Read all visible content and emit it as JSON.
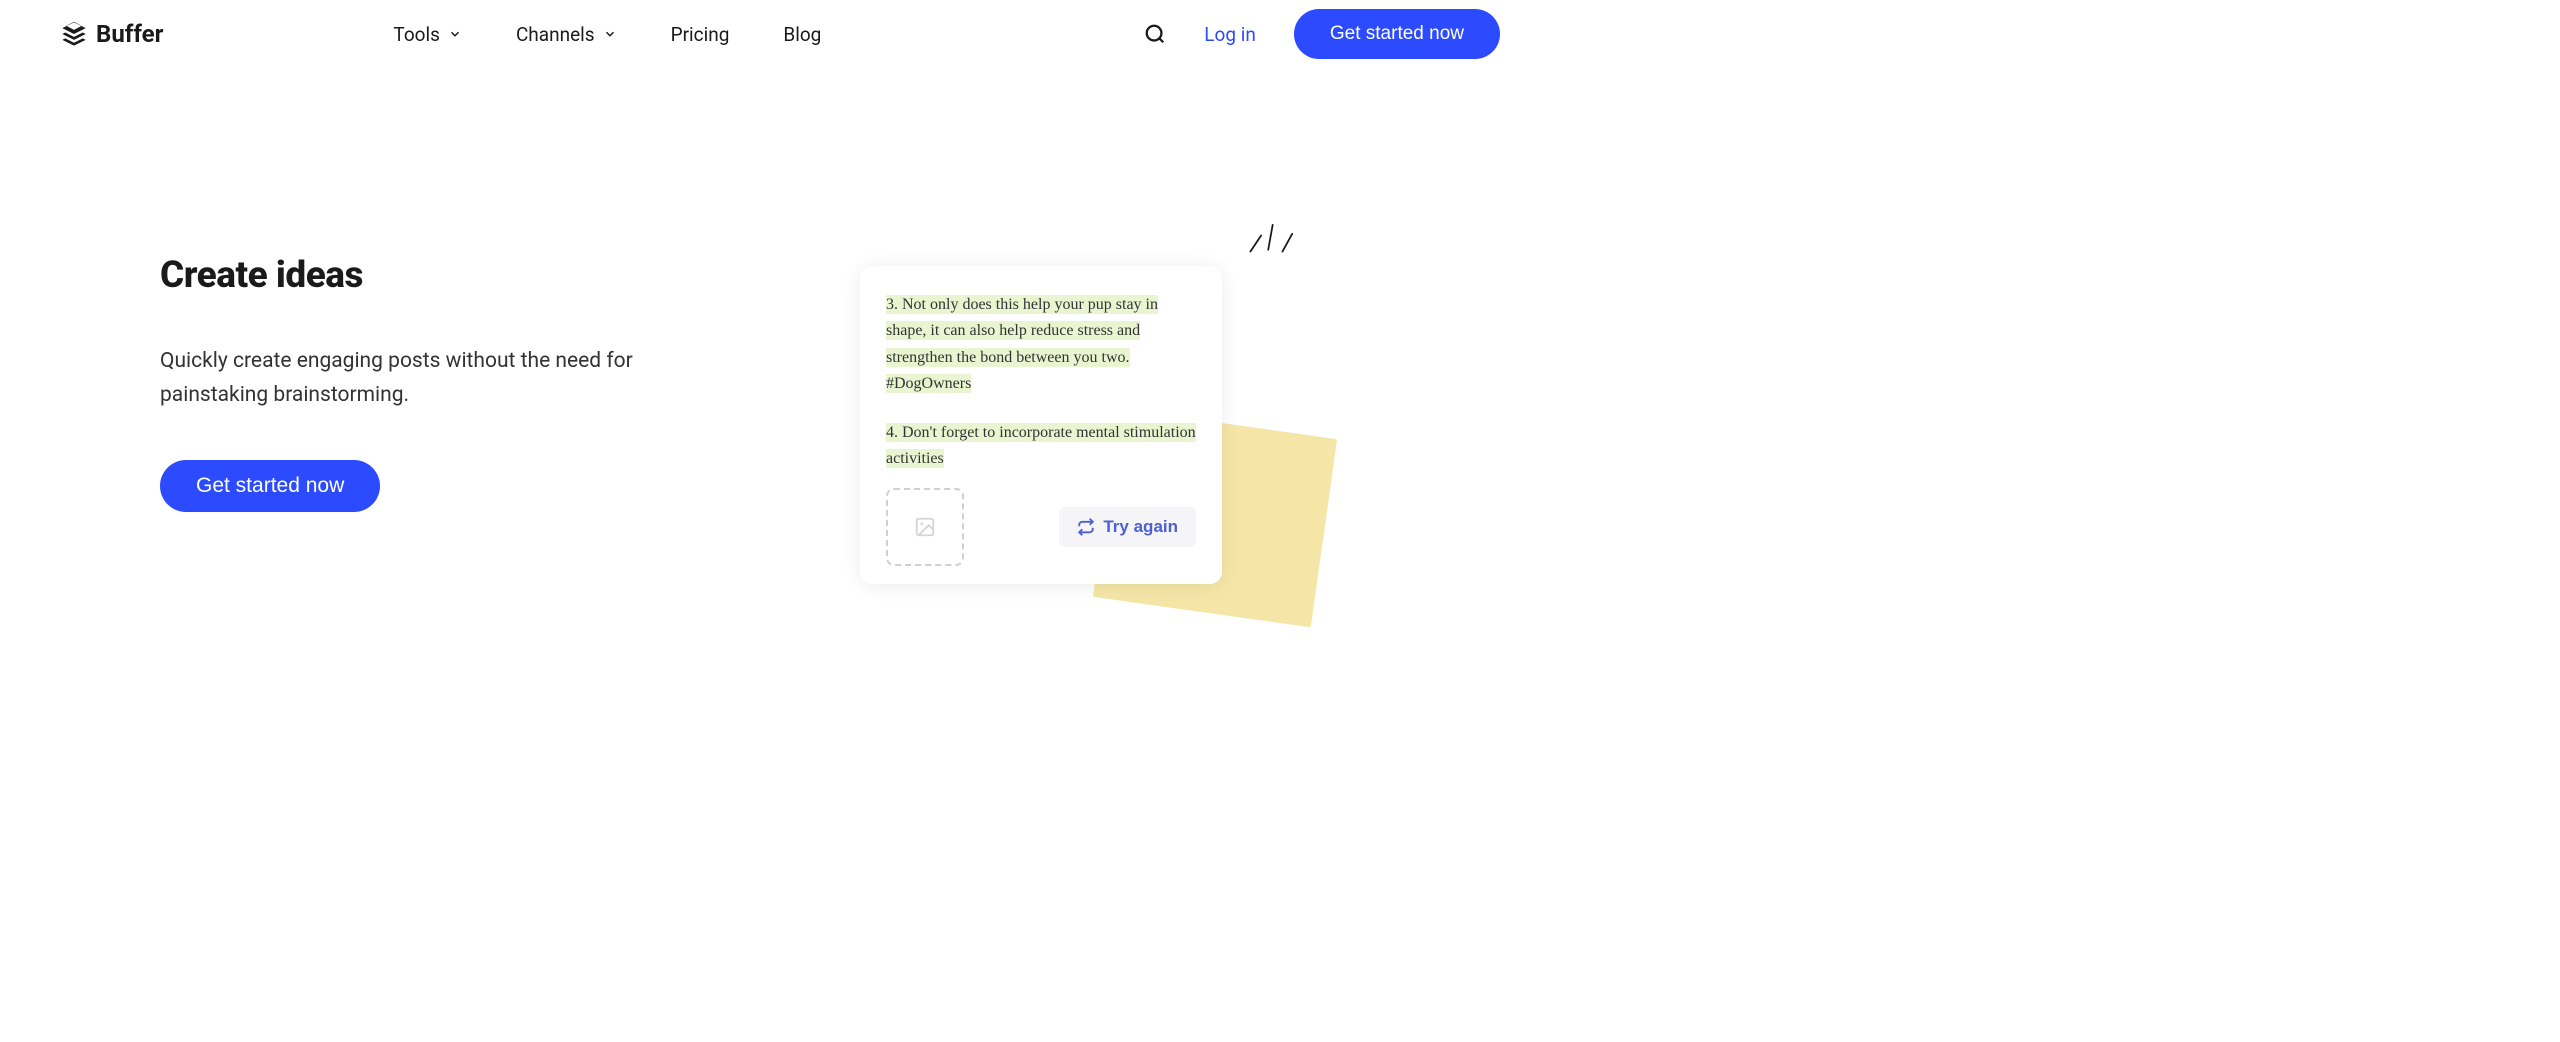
{
  "brand": {
    "name": "Buffer"
  },
  "nav": {
    "tools": "Tools",
    "channels": "Channels",
    "pricing": "Pricing",
    "blog": "Blog",
    "login": "Log in",
    "cta": "Get started now"
  },
  "hero": {
    "title": "Create ideas",
    "description": "Quickly create engaging posts without the need for painstaking brainstorming.",
    "cta": "Get started now"
  },
  "card": {
    "line1": "3. Not only does this help your pup stay in shape, it can also help reduce stress and strengthen the bond between you two. #DogOwners",
    "line2": "4. Don't forget to incorporate mental stimulation activities",
    "tryAgain": "Try again"
  }
}
